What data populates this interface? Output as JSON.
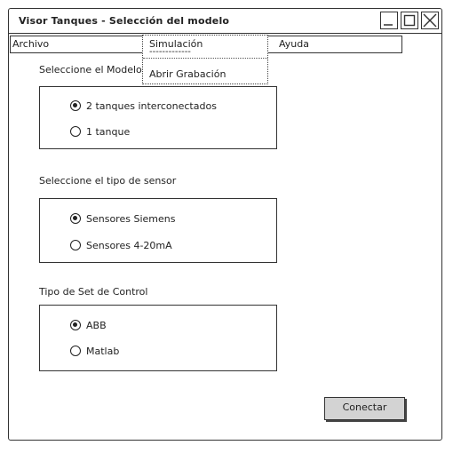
{
  "window": {
    "title": "Visor Tanques - Selección del modelo"
  },
  "menubar": {
    "archivo": "Archivo",
    "ayuda": "Ayuda"
  },
  "dropdown": {
    "items": [
      "Simulación",
      "-------------",
      "Abrir Grabación"
    ]
  },
  "model": {
    "label": "Seleccione el Modelo",
    "options": [
      "2 tanques interconectados",
      "1 tanque"
    ],
    "selected": 0
  },
  "sensor": {
    "label": "Seleccione el tipo de sensor",
    "options": [
      "Sensores Siemens",
      "Sensores 4-20mA"
    ],
    "selected": 0
  },
  "control": {
    "label": "Tipo de Set de Control",
    "options": [
      "ABB",
      "Matlab"
    ],
    "selected": 0
  },
  "actions": {
    "connect": "Conectar"
  },
  "colors": {
    "button_bg": "#d3d3d3",
    "stroke": "#333333"
  },
  "icons": [
    "minimize-icon",
    "maximize-icon",
    "close-icon",
    "radio-selected",
    "radio-unselected"
  ]
}
